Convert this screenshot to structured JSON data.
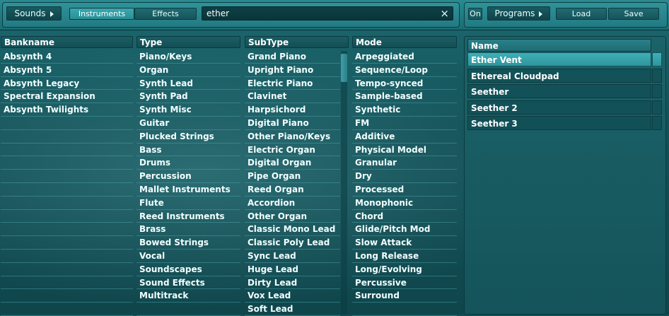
{
  "toolbar": {
    "sounds_label": "Sounds",
    "instruments_label": "Instruments",
    "effects_label": "Effects",
    "search_value": "ether",
    "clear_icon": "×",
    "on_label": "On",
    "programs_label": "Programs",
    "load_label": "Load",
    "save_label": "Save"
  },
  "columns": {
    "bankname": {
      "header": "Bankname",
      "items": [
        "Absynth 4",
        "Absynth 5",
        "Absynth Legacy",
        "Spectral Expansion",
        "Absynth Twilights"
      ]
    },
    "type": {
      "header": "Type",
      "items": [
        "Piano/Keys",
        "Organ",
        "Synth Lead",
        "Synth Pad",
        "Synth Misc",
        "Guitar",
        "Plucked Strings",
        "Bass",
        "Drums",
        "Percussion",
        "Mallet Instruments",
        "Flute",
        "Reed Instruments",
        "Brass",
        "Bowed Strings",
        "Vocal",
        "Soundscapes",
        "Sound Effects",
        "Multitrack"
      ]
    },
    "subtype": {
      "header": "SubType",
      "items": [
        "Grand Piano",
        "Upright Piano",
        "Electric Piano",
        "Clavinet",
        "Harpsichord",
        "Digital Piano",
        "Other Piano/Keys",
        "Electric Organ",
        "Digital Organ",
        "Pipe Organ",
        "Reed Organ",
        "Accordion",
        "Other Organ",
        "Classic Mono Lead",
        "Classic Poly Lead",
        "Sync Lead",
        "Huge Lead",
        "Dirty Lead",
        "Vox Lead",
        "Soft Lead"
      ]
    },
    "mode": {
      "header": "Mode",
      "items": [
        "Arpeggiated",
        "Sequence/Loop",
        "Tempo-synced",
        "Sample-based",
        "Synthetic",
        "FM",
        "Additive",
        "Physical Model",
        "Granular",
        "Dry",
        "Processed",
        "Monophonic",
        "Chord",
        "Glide/Pitch Mod",
        "Slow Attack",
        "Long Release",
        "Long/Evolving",
        "Percussive",
        "Surround"
      ]
    }
  },
  "results": {
    "header": "Name",
    "items": [
      "Ether Vent",
      "Ethereal Cloudpad",
      "Seether",
      "Seether 2",
      "Seether 3"
    ],
    "selected": "Ether Vent"
  },
  "colors": {
    "background": "#134f55",
    "accent": "#3fb0b8"
  }
}
